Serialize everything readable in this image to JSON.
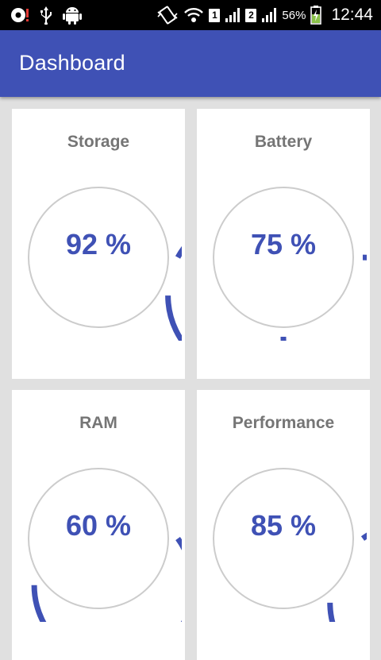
{
  "status_bar": {
    "icons": [
      "alert-icon",
      "usb-icon",
      "android-icon",
      "vibrate-icon",
      "wifi-icon",
      "signal-icon"
    ],
    "sim1": "1",
    "sim2": "2",
    "battery_percent": "56%",
    "time": "12:44"
  },
  "app_bar": {
    "title": "Dashboard"
  },
  "colors": {
    "primary": "#3f51b5",
    "track": "#cccccc",
    "title_text": "#757575"
  },
  "cards": [
    {
      "title": "Storage",
      "value_label": "92 %",
      "percent": 92
    },
    {
      "title": "Battery",
      "value_label": "75 %",
      "percent": 75
    },
    {
      "title": "RAM",
      "value_label": "60 %",
      "percent": 60
    },
    {
      "title": "Performance",
      "value_label": "85 %",
      "percent": 85
    }
  ]
}
